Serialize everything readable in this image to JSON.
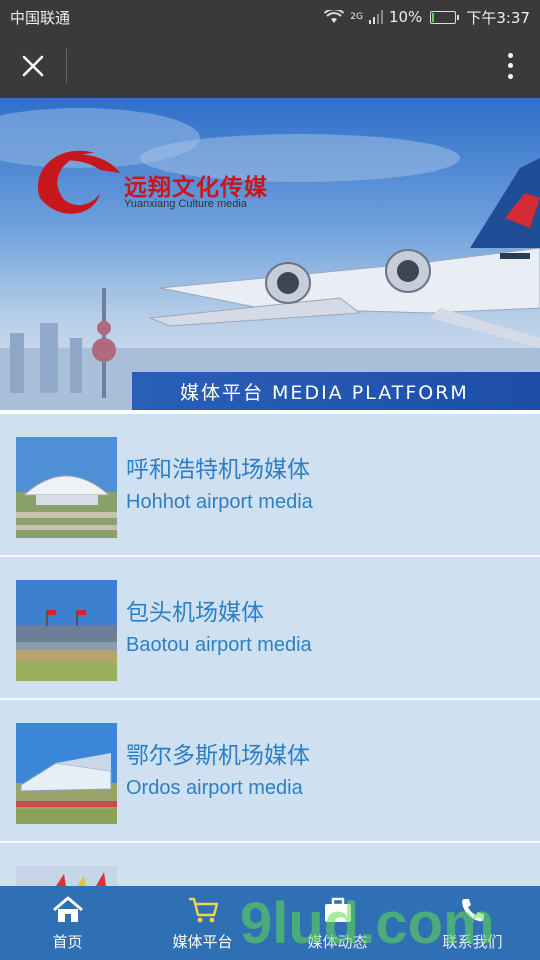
{
  "status_bar": {
    "carrier": "中国联通",
    "network": "2G",
    "battery": "10%",
    "battery_level": 0.1,
    "time": "下午3:37"
  },
  "banner": {
    "brand_cn": "远翔文化传媒",
    "brand_en": "Yuanxiang Culture media",
    "platform_label": "媒体平台  MEDIA PLATFORM"
  },
  "list": [
    {
      "title_cn": "呼和浩特机场媒体",
      "title_en": "Hohhot airport media"
    },
    {
      "title_cn": "包头机场媒体",
      "title_en": "Baotou airport media"
    },
    {
      "title_cn": "鄂尔多斯机场媒体",
      "title_en": "Ordos airport media"
    },
    {
      "title_cn": "",
      "title_en": ""
    }
  ],
  "tabbar": [
    {
      "label": "首页",
      "icon": "home-icon"
    },
    {
      "label": "媒体平台",
      "icon": "cart-icon"
    },
    {
      "label": "媒体动态",
      "icon": "briefcase-icon"
    },
    {
      "label": "联系我们",
      "icon": "phone-icon"
    }
  ],
  "watermark": "9lud.com",
  "colors": {
    "header_bg": "#3a3a3a",
    "list_bg": "#cfe0f0",
    "link_blue": "#2e7fc6",
    "tabbar_bg": "#2f6fb4",
    "brand_red": "#c8161d"
  }
}
